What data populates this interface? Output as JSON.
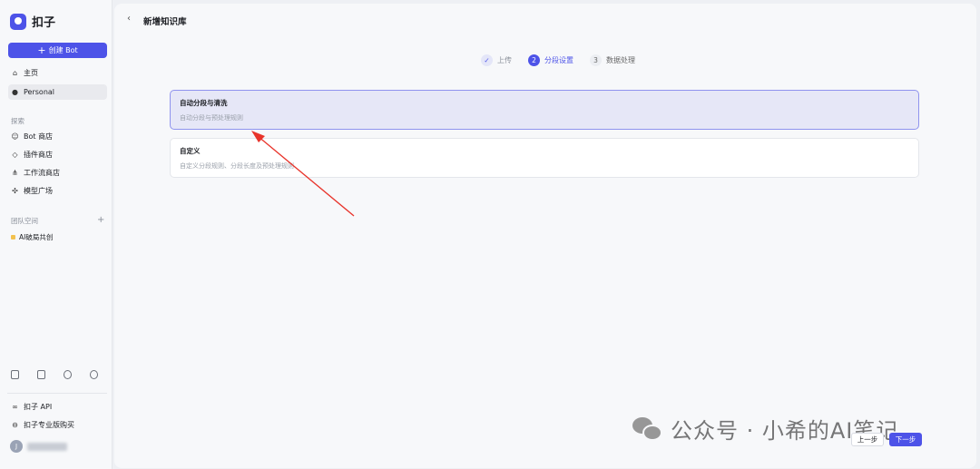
{
  "sidebar": {
    "brand": "扣子",
    "create_button": "创建 Bot",
    "home": "主页",
    "personal": "Personal",
    "explore_label": "探索",
    "explore_items": [
      "Bot 商店",
      "插件商店",
      "工作流商店",
      "模型广场"
    ],
    "team_label": "团队空间",
    "team_item": "AI破局共创",
    "api": "扣子 API",
    "pro": "扣子专业版购买",
    "avatar_initial": "J"
  },
  "header": {
    "title": "新增知识库"
  },
  "steps": [
    {
      "num": "✓",
      "label": "上传",
      "state": "done"
    },
    {
      "num": "2",
      "label": "分段设置",
      "state": "current"
    },
    {
      "num": "3",
      "label": "数据处理",
      "state": "todo"
    }
  ],
  "options": [
    {
      "title": "自动分段与清洗",
      "desc": "自动分段与预处理规则",
      "selected": true
    },
    {
      "title": "自定义",
      "desc": "自定义分段规则、分段长度及预处理规则",
      "selected": false
    }
  ],
  "footer": {
    "prev": "上一步",
    "next": "下一步"
  },
  "watermark": "公众号 · 小希的AI笔记",
  "colors": {
    "accent": "#4d53e8",
    "selected_bg": "#e6e7f7",
    "arrow": "#e8332a"
  }
}
